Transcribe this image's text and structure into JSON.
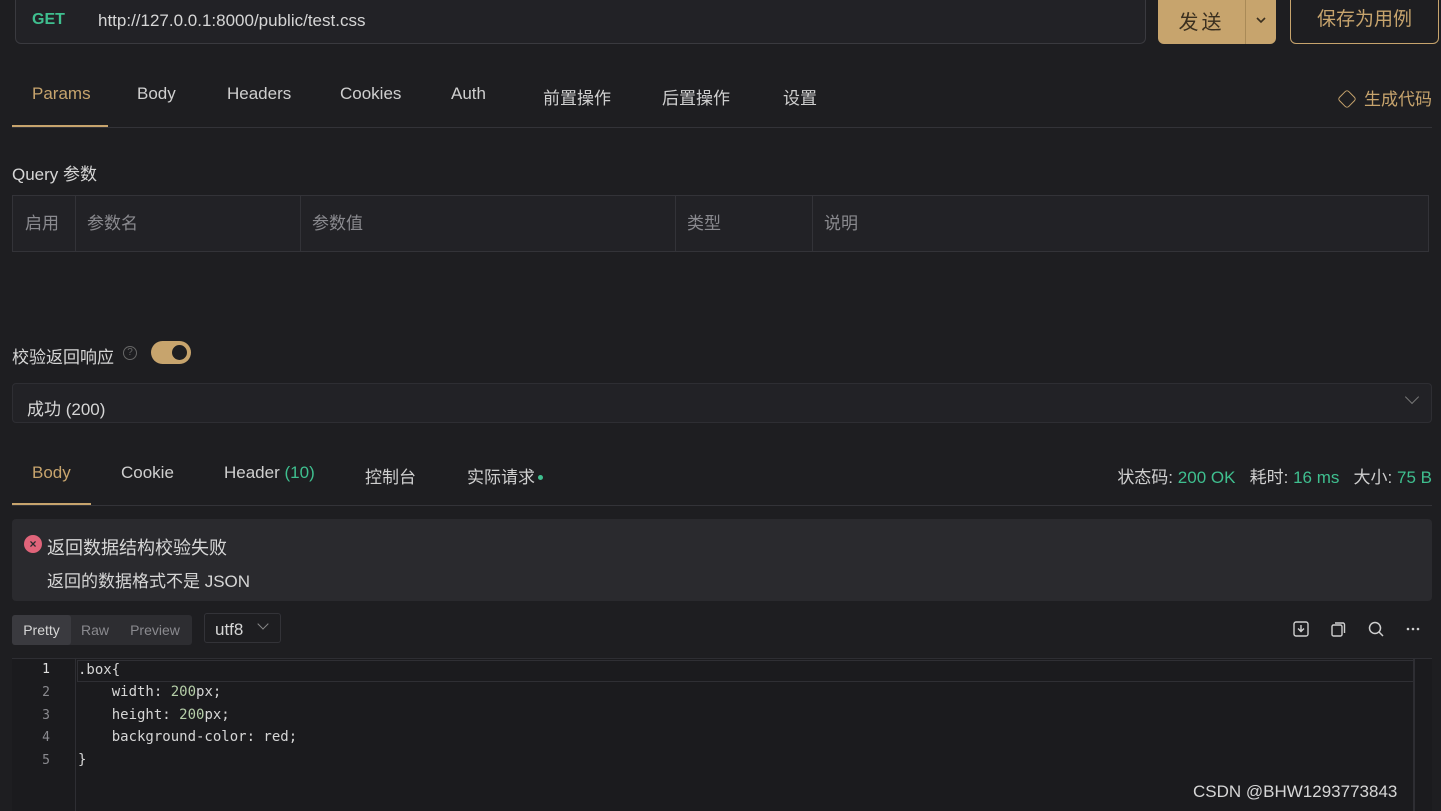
{
  "request": {
    "method": "GET",
    "url": "http://127.0.0.1:8000/public/test.css",
    "send_label": "发送",
    "save_label": "保存为用例"
  },
  "request_tabs": [
    "Params",
    "Body",
    "Headers",
    "Cookies",
    "Auth",
    "前置操作",
    "后置操作",
    "设置"
  ],
  "active_request_tab": "Params",
  "generate_code_label": "生成代码",
  "query": {
    "title": "Query 参数",
    "columns": [
      "启用",
      "参数名",
      "参数值",
      "类型",
      "说明"
    ]
  },
  "validation": {
    "label": "校验返回响应",
    "help": "?",
    "enabled": true,
    "selected": "成功 (200)"
  },
  "response_tabs": {
    "body": "Body",
    "cookie": "Cookie",
    "header": "Header",
    "header_count": "(10)",
    "console": "控制台",
    "actual": "实际请求"
  },
  "stats": {
    "status_label": "状态码:",
    "status_value": "200 OK",
    "time_label": "耗时:",
    "time_value": "16 ms",
    "size_label": "大小:",
    "size_value": "75 B"
  },
  "alert": {
    "title": "返回数据结构校验失败",
    "message": "返回的数据格式不是 JSON"
  },
  "view_modes": [
    "Pretty",
    "Raw",
    "Preview"
  ],
  "active_view_mode": "Pretty",
  "encoding": "utf8",
  "code_lines": [
    {
      "n": "1",
      "text": ".box{"
    },
    {
      "n": "2",
      "prop": "    width: ",
      "num": "200",
      "rest": "px;"
    },
    {
      "n": "3",
      "prop": "    height: ",
      "num": "200",
      "rest": "px;"
    },
    {
      "n": "4",
      "text": "    background-color: red;"
    },
    {
      "n": "5",
      "text": "}"
    }
  ],
  "watermark": "CSDN @BHW1293773843",
  "colors": {
    "accent": "#c7a46d",
    "success": "#3fbf8f",
    "error": "#e0647a",
    "background": "#1e1e21"
  }
}
